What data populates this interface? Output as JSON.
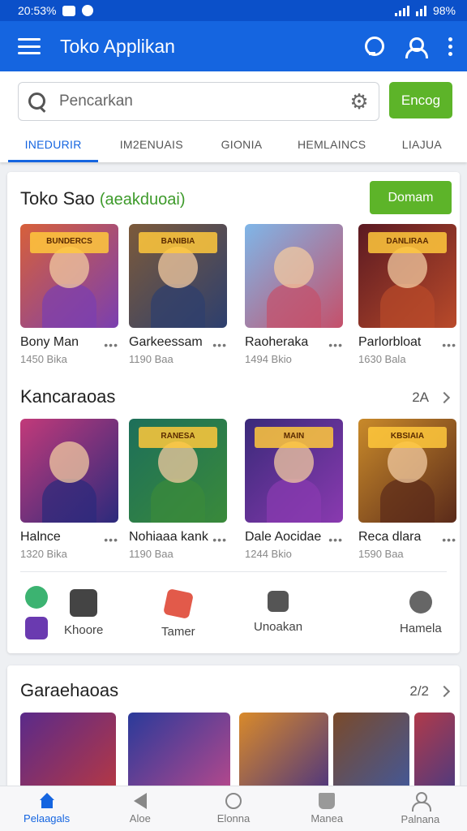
{
  "status": {
    "time": "20:53%",
    "battery": "98%"
  },
  "appbar": {
    "title": "Toko Applikan"
  },
  "search": {
    "placeholder": "Pencarkan",
    "button": "Encog"
  },
  "tabs": [
    "INEDURIR",
    "IM2ENUAIS",
    "GIONIA",
    "HEMLAINCS",
    "LIAJUA"
  ],
  "section1": {
    "title": "Toko Sao",
    "subtitle": "(aeakduoai)",
    "button": "Domam",
    "apps": [
      {
        "name": "Bony Man",
        "size": "1450 Bika",
        "logo": "BUNDERCS",
        "colors": [
          "#d7603a",
          "#7a3fb0"
        ]
      },
      {
        "name": "Garkeessam",
        "size": "1190 Baa",
        "logo": "BANIBIA",
        "colors": [
          "#7c5a3a",
          "#2d3f6e"
        ]
      },
      {
        "name": "Raoheraka",
        "size": "1494 Bkio",
        "logo": "",
        "colors": [
          "#7fb6e8",
          "#c5506a"
        ]
      },
      {
        "name": "Parlorbloat",
        "size": "1630 Bala",
        "logo": "DANLIRAA",
        "colors": [
          "#5b1a22",
          "#b94a2a"
        ]
      }
    ]
  },
  "section2": {
    "title": "Kancaraoas",
    "pager": "2A",
    "apps": [
      {
        "name": "Halnce",
        "size": "1320 Bika",
        "logo": "",
        "colors": [
          "#c23a7a",
          "#2b2a7c"
        ]
      },
      {
        "name": "Nohiaaa kank",
        "size": "1190 Baa",
        "logo": "RANESA",
        "colors": [
          "#1d6f5a",
          "#3a8a3a"
        ]
      },
      {
        "name": "Dale Aocidae",
        "size": "1244 Bkio",
        "logo": "MAIN",
        "colors": [
          "#3a2a7a",
          "#8a3ab0"
        ]
      },
      {
        "name": "Reca dlara",
        "size": "1590 Baa",
        "logo": "KBSIAIA",
        "colors": [
          "#c98a2a",
          "#5a2a1a"
        ]
      }
    ]
  },
  "shortcuts": [
    {
      "label": "Khoore",
      "color": "#3cb371"
    },
    {
      "label": "Tamer",
      "color": "#e25a4a"
    },
    {
      "label": "Unoakan",
      "color": "#555555"
    },
    {
      "label": "Hamela",
      "color": "#666666"
    }
  ],
  "section3": {
    "title": "Garaehaoas",
    "pager": "2/2"
  },
  "bottomnav": [
    "Pelaagals",
    "Aloe",
    "Elonna",
    "Manea",
    "Palnana"
  ]
}
